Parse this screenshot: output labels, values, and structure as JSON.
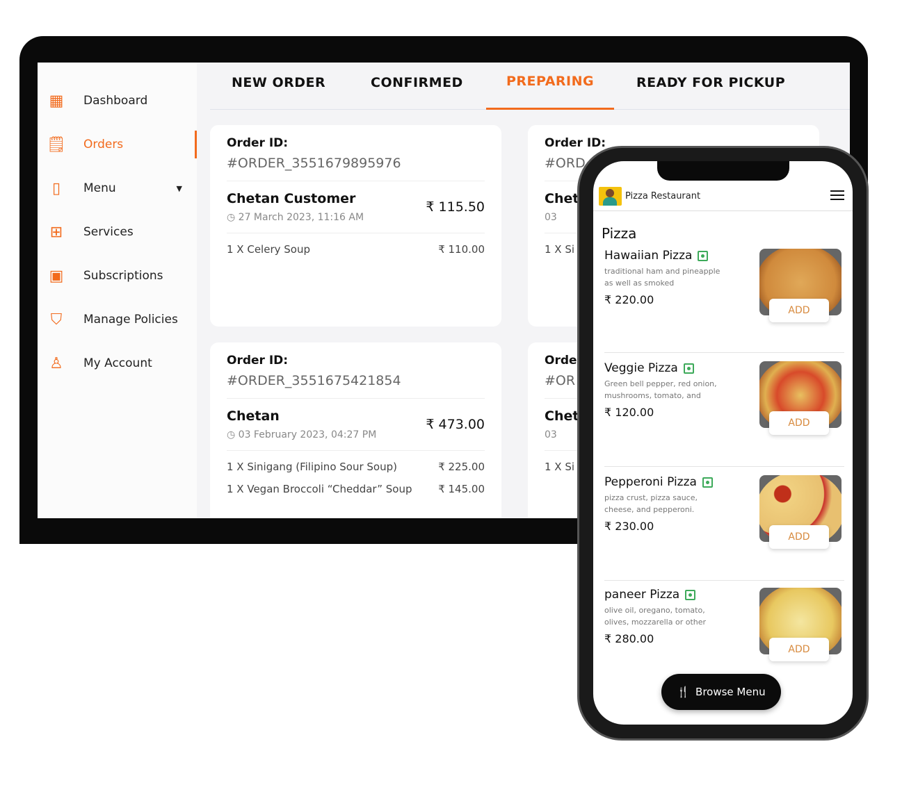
{
  "sidebar": {
    "items": [
      {
        "label": "Dashboard",
        "icon": "dashboard-icon"
      },
      {
        "label": "Orders",
        "icon": "orders-icon",
        "active": true
      },
      {
        "label": "Menu",
        "icon": "menu-icon",
        "has_dropdown": true
      },
      {
        "label": "Services",
        "icon": "services-icon"
      },
      {
        "label": "Subscriptions",
        "icon": "subscriptions-icon"
      },
      {
        "label": "Manage Policies",
        "icon": "shield-icon"
      },
      {
        "label": "My Account",
        "icon": "user-icon"
      }
    ]
  },
  "tabs": [
    "NEW ORDER",
    "CONFIRMED",
    "PREPARING",
    "READY FOR PICKUP"
  ],
  "active_tab": "PREPARING",
  "accent": "#f26b1d",
  "orders": [
    {
      "label": "Order ID:",
      "id": "#ORDER_3551679895976",
      "customer": "Chetan Customer",
      "date": "27 March 2023, 11:16 AM",
      "total": "₹ 115.50",
      "items": [
        {
          "name": "1 X  Celery Soup",
          "price": "₹ 110.00"
        }
      ]
    },
    {
      "label": "Order ID:",
      "id": "#ORDER_3551675421854",
      "customer": "Chetan",
      "date": "03 February 2023, 04:27 PM",
      "total": "₹ 473.00",
      "items": [
        {
          "name": "1 X  Sinigang (Filipino Sour Soup)",
          "price": "₹ 225.00"
        },
        {
          "name": "1 X  Vegan Broccoli “Cheddar” Soup",
          "price": "₹ 145.00"
        }
      ]
    },
    {
      "label": "Order ID:",
      "id": "#ORD",
      "customer": "Chet",
      "date": "03",
      "item": "1 X  Si"
    },
    {
      "label": "Orde",
      "id": "#OR",
      "customer": "Chet",
      "date": "03",
      "item": "1 X  Si"
    }
  ],
  "phone": {
    "restaurant": "Pizza Restaurant",
    "category": "Pizza",
    "add_label": "ADD",
    "browse_label": "Browse Menu",
    "items": [
      {
        "name": "Hawaiian Pizza",
        "desc": "traditional ham and pineapple as well as smoked",
        "price": "₹ 220.00"
      },
      {
        "name": "Veggie Pizza",
        "desc": "Green bell pepper, red onion, mushrooms, tomato, and",
        "price": "₹ 120.00"
      },
      {
        "name": "Pepperoni Pizza",
        "desc": "pizza crust, pizza sauce, cheese, and pepperoni.",
        "price": "₹ 230.00"
      },
      {
        "name": "paneer Pizza",
        "desc": "olive oil, oregano, tomato, olives, mozzarella or other",
        "price": "₹ 280.00"
      }
    ]
  }
}
